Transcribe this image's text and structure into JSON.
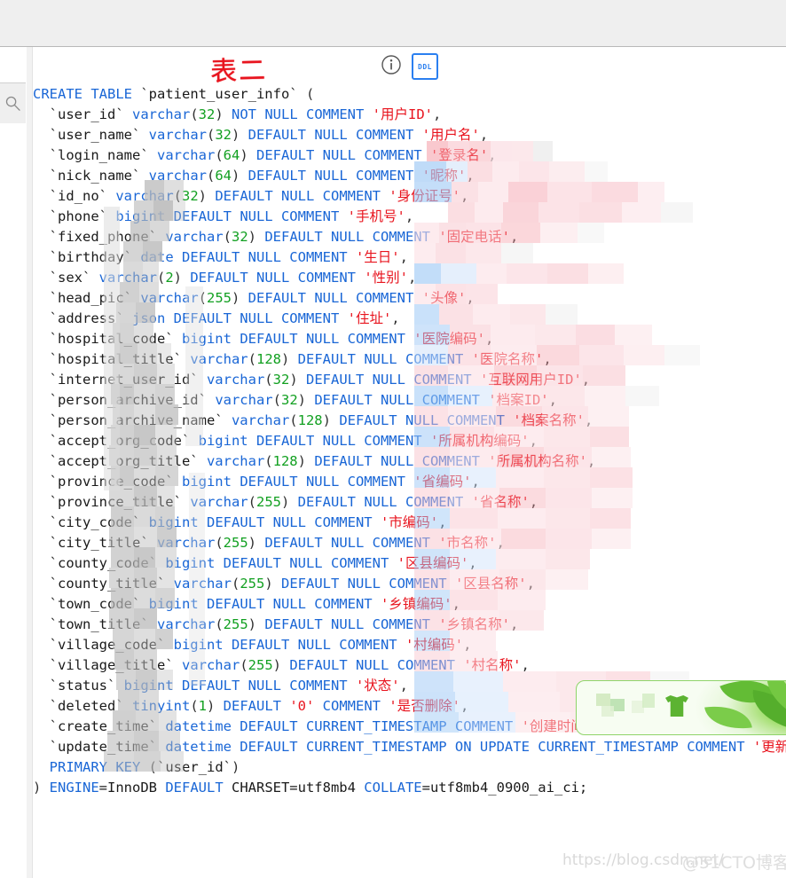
{
  "window": {
    "top_bar_color": "#efefef"
  },
  "rail": {
    "search_icon": "search-icon"
  },
  "ddl_header": {
    "info_icon": "info-circle-icon",
    "ddl_badge_label": "DDL",
    "annotation": "表二"
  },
  "colors": {
    "keyword": "#1966d6",
    "number": "#12a021",
    "string": "#e8141e",
    "identifier": "#1a1a1a",
    "accent_blue": "#2a7ff0",
    "annotation_red": "#e8141e"
  },
  "code": {
    "language": "sql",
    "table_name": "patient_user_info",
    "lines": [
      [
        {
          "t": "CREATE TABLE ",
          "c": "kw"
        },
        {
          "t": "`patient_user_info`",
          "c": "id"
        },
        {
          "t": " (",
          "c": "pun"
        }
      ],
      [
        {
          "t": "  `user_id` ",
          "c": "id"
        },
        {
          "t": "varchar",
          "c": "typ"
        },
        {
          "t": "(",
          "c": "pun"
        },
        {
          "t": "32",
          "c": "num"
        },
        {
          "t": ")",
          "c": "pun"
        },
        {
          "t": " NOT NULL COMMENT ",
          "c": "kw"
        },
        {
          "t": "'用户ID'",
          "c": "str"
        },
        {
          "t": ",",
          "c": "pun"
        }
      ],
      [
        {
          "t": "  `user_name` ",
          "c": "id"
        },
        {
          "t": "varchar",
          "c": "typ"
        },
        {
          "t": "(",
          "c": "pun"
        },
        {
          "t": "32",
          "c": "num"
        },
        {
          "t": ")",
          "c": "pun"
        },
        {
          "t": " DEFAULT NULL COMMENT ",
          "c": "kw"
        },
        {
          "t": "'用户名'",
          "c": "str"
        },
        {
          "t": ",",
          "c": "pun"
        }
      ],
      [
        {
          "t": "  `login_name` ",
          "c": "id"
        },
        {
          "t": "varchar",
          "c": "typ"
        },
        {
          "t": "(",
          "c": "pun"
        },
        {
          "t": "64",
          "c": "num"
        },
        {
          "t": ")",
          "c": "pun"
        },
        {
          "t": " DEFAULT NULL COMMENT ",
          "c": "kw"
        },
        {
          "t": "'登录名'",
          "c": "str"
        },
        {
          "t": ",",
          "c": "pun"
        }
      ],
      [
        {
          "t": "  `nick_name` ",
          "c": "id"
        },
        {
          "t": "varchar",
          "c": "typ"
        },
        {
          "t": "(",
          "c": "pun"
        },
        {
          "t": "64",
          "c": "num"
        },
        {
          "t": ")",
          "c": "pun"
        },
        {
          "t": " DEFAULT NULL COMMENT ",
          "c": "kw"
        },
        {
          "t": "'昵称'",
          "c": "str"
        },
        {
          "t": ",",
          "c": "pun"
        }
      ],
      [
        {
          "t": "  `id_no` ",
          "c": "id"
        },
        {
          "t": "varchar",
          "c": "typ"
        },
        {
          "t": "(",
          "c": "pun"
        },
        {
          "t": "32",
          "c": "num"
        },
        {
          "t": ")",
          "c": "pun"
        },
        {
          "t": " DEFAULT NULL COMMENT ",
          "c": "kw"
        },
        {
          "t": "'身份证号'",
          "c": "str"
        },
        {
          "t": ",",
          "c": "pun"
        }
      ],
      [
        {
          "t": "  `phone` ",
          "c": "id"
        },
        {
          "t": "bigint",
          "c": "typ"
        },
        {
          "t": " DEFAULT NULL COMMENT ",
          "c": "kw"
        },
        {
          "t": "'手机号'",
          "c": "str"
        },
        {
          "t": ",",
          "c": "pun"
        }
      ],
      [
        {
          "t": "  `fixed_phone` ",
          "c": "id"
        },
        {
          "t": "varchar",
          "c": "typ"
        },
        {
          "t": "(",
          "c": "pun"
        },
        {
          "t": "32",
          "c": "num"
        },
        {
          "t": ")",
          "c": "pun"
        },
        {
          "t": " DEFAULT NULL COMMENT ",
          "c": "kw"
        },
        {
          "t": "'固定电话'",
          "c": "str"
        },
        {
          "t": ",",
          "c": "pun"
        }
      ],
      [
        {
          "t": "  `birthday` ",
          "c": "id"
        },
        {
          "t": "date",
          "c": "typ"
        },
        {
          "t": " DEFAULT NULL COMMENT ",
          "c": "kw"
        },
        {
          "t": "'生日'",
          "c": "str"
        },
        {
          "t": ",",
          "c": "pun"
        }
      ],
      [
        {
          "t": "  `sex` ",
          "c": "id"
        },
        {
          "t": "varchar",
          "c": "typ"
        },
        {
          "t": "(",
          "c": "pun"
        },
        {
          "t": "2",
          "c": "num"
        },
        {
          "t": ")",
          "c": "pun"
        },
        {
          "t": " DEFAULT NULL COMMENT ",
          "c": "kw"
        },
        {
          "t": "'性别'",
          "c": "str"
        },
        {
          "t": ",",
          "c": "pun"
        }
      ],
      [
        {
          "t": "  `head_pic` ",
          "c": "id"
        },
        {
          "t": "varchar",
          "c": "typ"
        },
        {
          "t": "(",
          "c": "pun"
        },
        {
          "t": "255",
          "c": "num"
        },
        {
          "t": ")",
          "c": "pun"
        },
        {
          "t": " DEFAULT NULL COMMENT ",
          "c": "kw"
        },
        {
          "t": "'头像'",
          "c": "str"
        },
        {
          "t": ",",
          "c": "pun"
        }
      ],
      [
        {
          "t": "  `address` ",
          "c": "id"
        },
        {
          "t": "json",
          "c": "typ"
        },
        {
          "t": " DEFAULT NULL COMMENT ",
          "c": "kw"
        },
        {
          "t": "'住址'",
          "c": "str"
        },
        {
          "t": ",",
          "c": "pun"
        }
      ],
      [
        {
          "t": "  `hospital_code` ",
          "c": "id"
        },
        {
          "t": "bigint",
          "c": "typ"
        },
        {
          "t": " DEFAULT NULL COMMENT ",
          "c": "kw"
        },
        {
          "t": "'医院编码'",
          "c": "str"
        },
        {
          "t": ",",
          "c": "pun"
        }
      ],
      [
        {
          "t": "  `hospital_title` ",
          "c": "id"
        },
        {
          "t": "varchar",
          "c": "typ"
        },
        {
          "t": "(",
          "c": "pun"
        },
        {
          "t": "128",
          "c": "num"
        },
        {
          "t": ")",
          "c": "pun"
        },
        {
          "t": " DEFAULT NULL COMMENT ",
          "c": "kw"
        },
        {
          "t": "'医院名称'",
          "c": "str"
        },
        {
          "t": ",",
          "c": "pun"
        }
      ],
      [
        {
          "t": "  `internet_user_id` ",
          "c": "id"
        },
        {
          "t": "varchar",
          "c": "typ"
        },
        {
          "t": "(",
          "c": "pun"
        },
        {
          "t": "32",
          "c": "num"
        },
        {
          "t": ")",
          "c": "pun"
        },
        {
          "t": " DEFAULT NULL COMMENT ",
          "c": "kw"
        },
        {
          "t": "'互联网用户ID'",
          "c": "str"
        },
        {
          "t": ",",
          "c": "pun"
        }
      ],
      [
        {
          "t": "  `person_archive_id` ",
          "c": "id"
        },
        {
          "t": "varchar",
          "c": "typ"
        },
        {
          "t": "(",
          "c": "pun"
        },
        {
          "t": "32",
          "c": "num"
        },
        {
          "t": ")",
          "c": "pun"
        },
        {
          "t": " DEFAULT NULL COMMENT ",
          "c": "kw"
        },
        {
          "t": "'档案ID'",
          "c": "str"
        },
        {
          "t": ",",
          "c": "pun"
        }
      ],
      [
        {
          "t": "  `person_archive_name` ",
          "c": "id"
        },
        {
          "t": "varchar",
          "c": "typ"
        },
        {
          "t": "(",
          "c": "pun"
        },
        {
          "t": "128",
          "c": "num"
        },
        {
          "t": ")",
          "c": "pun"
        },
        {
          "t": " DEFAULT NULL COMMENT ",
          "c": "kw"
        },
        {
          "t": "'档案名称'",
          "c": "str"
        },
        {
          "t": ",",
          "c": "pun"
        }
      ],
      [
        {
          "t": "  `accept_org_code` ",
          "c": "id"
        },
        {
          "t": "bigint",
          "c": "typ"
        },
        {
          "t": " DEFAULT NULL COMMENT ",
          "c": "kw"
        },
        {
          "t": "'所属机构编码'",
          "c": "str"
        },
        {
          "t": ",",
          "c": "pun"
        }
      ],
      [
        {
          "t": "  `accept_org_title` ",
          "c": "id"
        },
        {
          "t": "varchar",
          "c": "typ"
        },
        {
          "t": "(",
          "c": "pun"
        },
        {
          "t": "128",
          "c": "num"
        },
        {
          "t": ")",
          "c": "pun"
        },
        {
          "t": " DEFAULT NULL COMMENT ",
          "c": "kw"
        },
        {
          "t": "'所属机构名称'",
          "c": "str"
        },
        {
          "t": ",",
          "c": "pun"
        }
      ],
      [
        {
          "t": "  `province_code` ",
          "c": "id"
        },
        {
          "t": "bigint",
          "c": "typ"
        },
        {
          "t": " DEFAULT NULL COMMENT ",
          "c": "kw"
        },
        {
          "t": "'省编码'",
          "c": "str"
        },
        {
          "t": ",",
          "c": "pun"
        }
      ],
      [
        {
          "t": "  `province_title` ",
          "c": "id"
        },
        {
          "t": "varchar",
          "c": "typ"
        },
        {
          "t": "(",
          "c": "pun"
        },
        {
          "t": "255",
          "c": "num"
        },
        {
          "t": ")",
          "c": "pun"
        },
        {
          "t": " DEFAULT NULL COMMENT ",
          "c": "kw"
        },
        {
          "t": "'省名称'",
          "c": "str"
        },
        {
          "t": ",",
          "c": "pun"
        }
      ],
      [
        {
          "t": "  `city_code` ",
          "c": "id"
        },
        {
          "t": "bigint",
          "c": "typ"
        },
        {
          "t": " DEFAULT NULL COMMENT ",
          "c": "kw"
        },
        {
          "t": "'市编码'",
          "c": "str"
        },
        {
          "t": ",",
          "c": "pun"
        }
      ],
      [
        {
          "t": "  `city_title` ",
          "c": "id"
        },
        {
          "t": "varchar",
          "c": "typ"
        },
        {
          "t": "(",
          "c": "pun"
        },
        {
          "t": "255",
          "c": "num"
        },
        {
          "t": ")",
          "c": "pun"
        },
        {
          "t": " DEFAULT NULL COMMENT ",
          "c": "kw"
        },
        {
          "t": "'市名称'",
          "c": "str"
        },
        {
          "t": ",",
          "c": "pun"
        }
      ],
      [
        {
          "t": "  `county_code` ",
          "c": "id"
        },
        {
          "t": "bigint",
          "c": "typ"
        },
        {
          "t": " DEFAULT NULL COMMENT ",
          "c": "kw"
        },
        {
          "t": "'区县编码'",
          "c": "str"
        },
        {
          "t": ",",
          "c": "pun"
        }
      ],
      [
        {
          "t": "  `county_title` ",
          "c": "id"
        },
        {
          "t": "varchar",
          "c": "typ"
        },
        {
          "t": "(",
          "c": "pun"
        },
        {
          "t": "255",
          "c": "num"
        },
        {
          "t": ")",
          "c": "pun"
        },
        {
          "t": " DEFAULT NULL COMMENT ",
          "c": "kw"
        },
        {
          "t": "'区县名称'",
          "c": "str"
        },
        {
          "t": ",",
          "c": "pun"
        }
      ],
      [
        {
          "t": "  `town_code` ",
          "c": "id"
        },
        {
          "t": "bigint",
          "c": "typ"
        },
        {
          "t": " DEFAULT NULL COMMENT ",
          "c": "kw"
        },
        {
          "t": "'乡镇编码'",
          "c": "str"
        },
        {
          "t": ",",
          "c": "pun"
        }
      ],
      [
        {
          "t": "  `town_title` ",
          "c": "id"
        },
        {
          "t": "varchar",
          "c": "typ"
        },
        {
          "t": "(",
          "c": "pun"
        },
        {
          "t": "255",
          "c": "num"
        },
        {
          "t": ")",
          "c": "pun"
        },
        {
          "t": " DEFAULT NULL COMMENT ",
          "c": "kw"
        },
        {
          "t": "'乡镇名称'",
          "c": "str"
        },
        {
          "t": ",",
          "c": "pun"
        }
      ],
      [
        {
          "t": "  `village_code` ",
          "c": "id"
        },
        {
          "t": "bigint",
          "c": "typ"
        },
        {
          "t": " DEFAULT NULL COMMENT ",
          "c": "kw"
        },
        {
          "t": "'村编码'",
          "c": "str"
        },
        {
          "t": ",",
          "c": "pun"
        }
      ],
      [
        {
          "t": "  `village_title` ",
          "c": "id"
        },
        {
          "t": "varchar",
          "c": "typ"
        },
        {
          "t": "(",
          "c": "pun"
        },
        {
          "t": "255",
          "c": "num"
        },
        {
          "t": ")",
          "c": "pun"
        },
        {
          "t": " DEFAULT NULL COMMENT ",
          "c": "kw"
        },
        {
          "t": "'村名称'",
          "c": "str"
        },
        {
          "t": ",",
          "c": "pun"
        }
      ],
      [
        {
          "t": "  `status` ",
          "c": "id"
        },
        {
          "t": "bigint",
          "c": "typ"
        },
        {
          "t": " DEFAULT NULL COMMENT ",
          "c": "kw"
        },
        {
          "t": "'状态'",
          "c": "str"
        },
        {
          "t": ",",
          "c": "pun"
        }
      ],
      [
        {
          "t": "  `deleted` ",
          "c": "id"
        },
        {
          "t": "tinyint",
          "c": "typ"
        },
        {
          "t": "(",
          "c": "pun"
        },
        {
          "t": "1",
          "c": "num"
        },
        {
          "t": ")",
          "c": "pun"
        },
        {
          "t": " DEFAULT ",
          "c": "kw"
        },
        {
          "t": "'0'",
          "c": "str"
        },
        {
          "t": " COMMENT ",
          "c": "kw"
        },
        {
          "t": "'是否删除'",
          "c": "str"
        },
        {
          "t": ",",
          "c": "pun"
        }
      ],
      [
        {
          "t": "  `create_time` ",
          "c": "id"
        },
        {
          "t": "datetime",
          "c": "typ"
        },
        {
          "t": " DEFAULT CURRENT_TIMESTAMP COMMENT ",
          "c": "kw"
        },
        {
          "t": "'创建时间'",
          "c": "str"
        },
        {
          "t": ",",
          "c": "pun"
        }
      ],
      [
        {
          "t": "  `update_time` ",
          "c": "id"
        },
        {
          "t": "datetime",
          "c": "typ"
        },
        {
          "t": " DEFAULT CURRENT_TIMESTAMP ON UPDATE CURRENT_TIMESTAMP COMMENT ",
          "c": "kw"
        },
        {
          "t": "'更新时间'",
          "c": "str"
        },
        {
          "t": ",",
          "c": "pun"
        }
      ],
      [
        {
          "t": "  PRIMARY KEY ",
          "c": "kw"
        },
        {
          "t": "(",
          "c": "pun"
        },
        {
          "t": "`user_id`",
          "c": "id"
        },
        {
          "t": ")",
          "c": "pun"
        }
      ],
      [
        {
          "t": ") ",
          "c": "pun"
        },
        {
          "t": "ENGINE",
          "c": "kw"
        },
        {
          "t": "=InnoDB ",
          "c": "id"
        },
        {
          "t": "DEFAULT",
          "c": "kw"
        },
        {
          "t": " CHARSET=utf8mb4 ",
          "c": "id"
        },
        {
          "t": "COLLATE",
          "c": "kw"
        },
        {
          "t": "=utf8mb4_0900_ai_ci;",
          "c": "id"
        }
      ]
    ]
  },
  "watermarks": {
    "csdn": "https://blog.csdn.net/",
    "cto": "@51CTO博客"
  }
}
